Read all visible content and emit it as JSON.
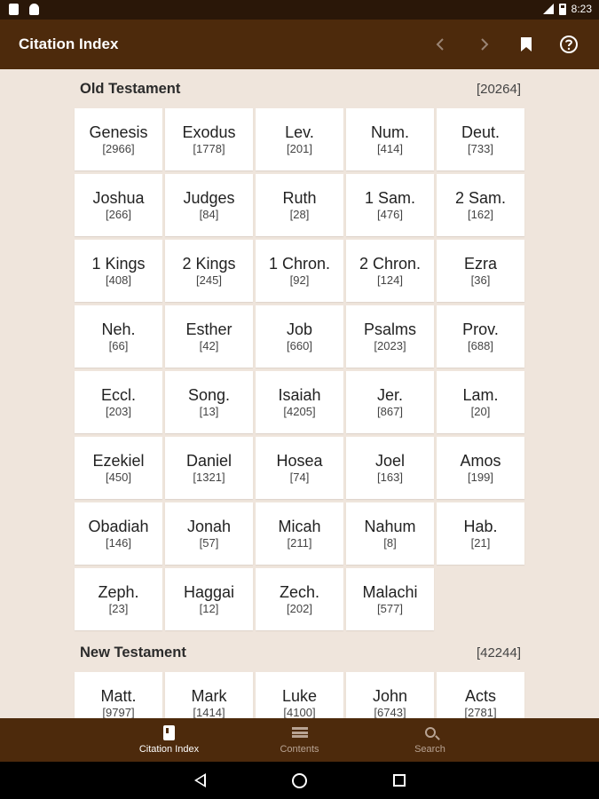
{
  "status_bar": {
    "time": "8:23"
  },
  "app_bar": {
    "title": "Citation Index",
    "actions": [
      {
        "name": "back-arrow-icon",
        "glyph": "‹"
      },
      {
        "name": "forward-arrow-icon",
        "glyph": "›"
      },
      {
        "name": "bookmark-icon",
        "glyph": ""
      },
      {
        "name": "help-icon",
        "glyph": "?"
      }
    ]
  },
  "old_testament": {
    "title": "Old Testament",
    "count": "[20264]",
    "books": [
      {
        "name": "Genesis",
        "count": "[2966]"
      },
      {
        "name": "Exodus",
        "count": "[1778]"
      },
      {
        "name": "Lev.",
        "count": "[201]"
      },
      {
        "name": "Num.",
        "count": "[414]"
      },
      {
        "name": "Deut.",
        "count": "[733]"
      },
      {
        "name": "Joshua",
        "count": "[266]"
      },
      {
        "name": "Judges",
        "count": "[84]"
      },
      {
        "name": "Ruth",
        "count": "[28]"
      },
      {
        "name": "1 Sam.",
        "count": "[476]"
      },
      {
        "name": "2 Sam.",
        "count": "[162]"
      },
      {
        "name": "1 Kings",
        "count": "[408]"
      },
      {
        "name": "2 Kings",
        "count": "[245]"
      },
      {
        "name": "1 Chron.",
        "count": "[92]"
      },
      {
        "name": "2 Chron.",
        "count": "[124]"
      },
      {
        "name": "Ezra",
        "count": "[36]"
      },
      {
        "name": "Neh.",
        "count": "[66]"
      },
      {
        "name": "Esther",
        "count": "[42]"
      },
      {
        "name": "Job",
        "count": "[660]"
      },
      {
        "name": "Psalms",
        "count": "[2023]"
      },
      {
        "name": "Prov.",
        "count": "[688]"
      },
      {
        "name": "Eccl.",
        "count": "[203]"
      },
      {
        "name": "Song.",
        "count": "[13]"
      },
      {
        "name": "Isaiah",
        "count": "[4205]"
      },
      {
        "name": "Jer.",
        "count": "[867]"
      },
      {
        "name": "Lam.",
        "count": "[20]"
      },
      {
        "name": "Ezekiel",
        "count": "[450]"
      },
      {
        "name": "Daniel",
        "count": "[1321]"
      },
      {
        "name": "Hosea",
        "count": "[74]"
      },
      {
        "name": "Joel",
        "count": "[163]"
      },
      {
        "name": "Amos",
        "count": "[199]"
      },
      {
        "name": "Obadiah",
        "count": "[146]"
      },
      {
        "name": "Jonah",
        "count": "[57]"
      },
      {
        "name": "Micah",
        "count": "[211]"
      },
      {
        "name": "Nahum",
        "count": "[8]"
      },
      {
        "name": "Hab.",
        "count": "[21]"
      },
      {
        "name": "Zeph.",
        "count": "[23]"
      },
      {
        "name": "Haggai",
        "count": "[12]"
      },
      {
        "name": "Zech.",
        "count": "[202]"
      },
      {
        "name": "Malachi",
        "count": "[577]"
      }
    ]
  },
  "new_testament": {
    "title": "New Testament",
    "count": "[42244]",
    "books": [
      {
        "name": "Matt.",
        "count": "[9797]"
      },
      {
        "name": "Mark",
        "count": "[1414]"
      },
      {
        "name": "Luke",
        "count": "[4100]"
      },
      {
        "name": "John",
        "count": "[6743]"
      },
      {
        "name": "Acts",
        "count": "[2781]"
      }
    ]
  },
  "bottom_nav": {
    "items": [
      {
        "label": "Citation Index",
        "icon": "book-icon",
        "active": true
      },
      {
        "label": "Contents",
        "icon": "list-icon",
        "active": false
      },
      {
        "label": "Search",
        "icon": "search-icon",
        "active": false
      }
    ]
  }
}
